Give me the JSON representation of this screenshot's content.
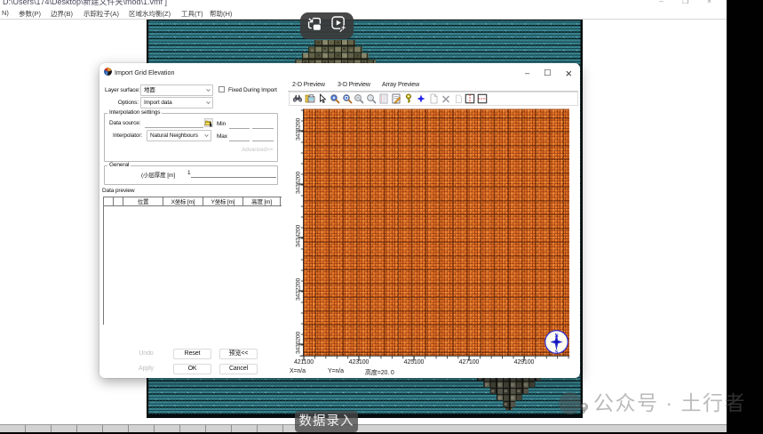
{
  "window": {
    "title_path": "D:\\Users\\174\\Desktop\\新建文件夹\\mod\\1.vmf ]",
    "minimize": "–",
    "restore": "❐",
    "close": "×"
  },
  "menu": {
    "items": [
      "N)",
      "参数(P)",
      "边界(B)",
      "示踪粒子(A)",
      "区域水均衡(Z)",
      "工具(T)",
      "帮助(H)"
    ]
  },
  "dialog": {
    "title": "Import Grid Elevation",
    "minimize": "–",
    "maximize": "☐",
    "close": "×",
    "form": {
      "layer_surface_label": "Layer surface:",
      "layer_surface_value": "地面",
      "fixed_checkbox_label": "Fixed During Import",
      "options_label": "Options:",
      "options_value": "Import data",
      "interpolation_group_label": "Interpolation settings",
      "data_source_label": "Data source:",
      "min_label": "Min",
      "interpolator_label": "Interpolator:",
      "interpolator_value": "Natural Neighbours",
      "max_label": "Max",
      "advanced_label": "Advanced>>",
      "general_group_label": "General",
      "thickness_label": "(小层厚度 [m]",
      "thickness_value": "1",
      "data_preview_label": "Data preview",
      "table_headers": [
        "",
        "",
        "位置",
        "X坐标 [m]",
        "Y坐标 [m]",
        "高度 [m]"
      ],
      "undo_label": "Undo",
      "reset_label": "Reset",
      "preview_btn_label": "预览<<",
      "apply_label": "Apply",
      "ok_label": "OK",
      "cancel_label": "Cancel"
    },
    "preview": {
      "tabs": [
        "2-D Preview",
        "3-D Preview",
        "Array Preview"
      ],
      "active_tab": "2-D Preview",
      "x_ticks": [
        "421100",
        "423100",
        "425100",
        "427100",
        "429100"
      ],
      "y_ticks": [
        "3438200",
        "3436200",
        "3434200",
        "3432200",
        "3430200"
      ],
      "status_x": "X=n/a",
      "status_y": "Y=n/a",
      "status_elev": "高度=20. 0",
      "compass_n": "N",
      "compass_s": "S"
    }
  },
  "caption": {
    "text": "数据录入"
  },
  "watermark": {
    "text": "公众号 · 土行者"
  },
  "colors": {
    "map_teal": "#37838E",
    "grid_orange": "#ED7D2B",
    "overlay_dark": "#3a3a3a",
    "statusbar_gray": "#d2d2d2",
    "letterbox": "#010101"
  }
}
